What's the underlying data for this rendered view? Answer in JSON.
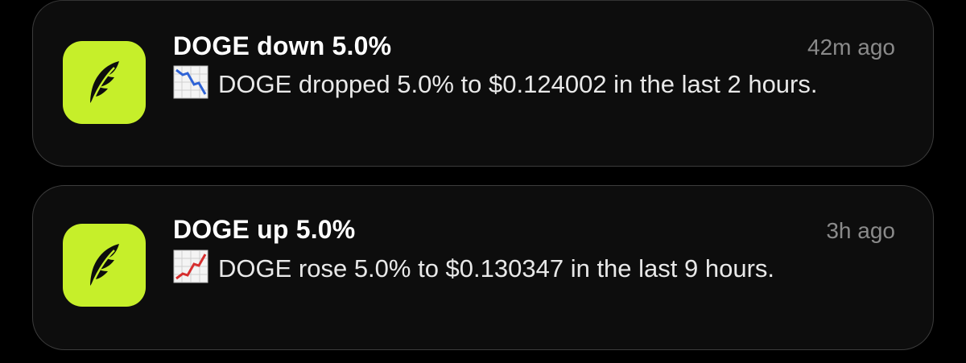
{
  "notifications": [
    {
      "app_icon": "robinhood-feather-icon",
      "title": "DOGE down 5.0%",
      "time": "42m ago",
      "emoji": "chart-decreasing-icon",
      "body": "DOGE dropped 5.0% to $0.124002 in the last 2 hours."
    },
    {
      "app_icon": "robinhood-feather-icon",
      "title": "DOGE up 5.0%",
      "time": "3h ago",
      "emoji": "chart-increasing-icon",
      "body": "DOGE rose 5.0% to $0.130347 in the last 9 hours."
    }
  ],
  "colors": {
    "icon_bg": "#c6ef2a",
    "card_bg": "#0d0d0d",
    "timestamp": "#8a8a8a"
  }
}
